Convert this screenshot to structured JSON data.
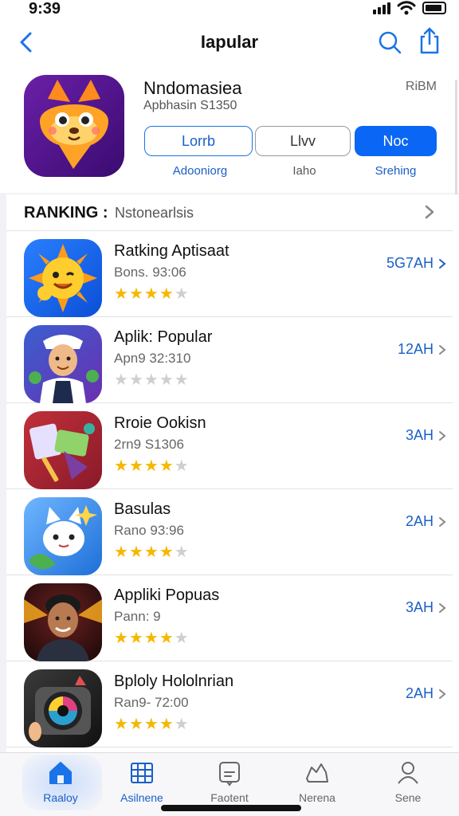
{
  "status_bar": {
    "time": "9:39"
  },
  "nav": {
    "title": "Iapular",
    "back_icon": "chevron-left-icon",
    "search_icon": "search-icon",
    "share_icon": "share-icon"
  },
  "header": {
    "app_name": "Nndomasiea",
    "app_sub": "Apbhasin S1350",
    "extra": "RiBM",
    "buttons": [
      "Lorrb",
      "Llvv",
      "Noc"
    ],
    "captions": [
      "Adooniorg",
      "Iaho",
      "Srehing"
    ]
  },
  "ranking": {
    "title": "RANKING :",
    "subtitle": "Nstonearlsis",
    "items": [
      {
        "name": "Ratking Aptisaat",
        "meta": "Bons. 93:06",
        "rating": 4,
        "action": "5G7AH"
      },
      {
        "name": "Aplik: Popular",
        "meta": "Apn9 32:310",
        "rating": 0,
        "action": "12AH"
      },
      {
        "name": "Rroie Ookisn",
        "meta": "2rn9 S1306",
        "rating": 4,
        "action": "3AH"
      },
      {
        "name": "Basulas",
        "meta": "Rano 93:96",
        "rating": 4,
        "action": "2AH"
      },
      {
        "name": "Appliki Popuas",
        "meta": "Pann: 9",
        "rating": 4,
        "action": "3AH"
      },
      {
        "name": "Bploly Hololnrian",
        "meta": "Ran9- 72:00",
        "rating": 4,
        "action": "2AH"
      }
    ]
  },
  "tabs": [
    {
      "label": "Raaloy",
      "icon": "home-icon",
      "active": true
    },
    {
      "label": "Asilnene",
      "icon": "grid-icon",
      "active": false
    },
    {
      "label": "Faotent",
      "icon": "message-icon",
      "active": false
    },
    {
      "label": "Nerena",
      "icon": "map-icon",
      "active": false
    },
    {
      "label": "Sene",
      "icon": "person-icon",
      "active": false
    }
  ],
  "colors": {
    "accent": "#0a66f5",
    "star": "#f5b800",
    "link": "#1a5fc7"
  }
}
